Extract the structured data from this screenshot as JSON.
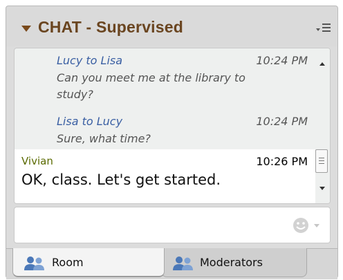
{
  "header": {
    "title": "CHAT - Supervised",
    "collapse_icon": "triangle-down-icon",
    "menu_icon": "options-menu-icon"
  },
  "messages": [
    {
      "sender": "Lucy to Lisa",
      "time": "10:24 PM",
      "text": "Can you meet me at the library to study?"
    },
    {
      "sender": "Lisa to Lucy",
      "time": "10:24 PM",
      "text": "Sure, what time?"
    }
  ],
  "current_message": {
    "sender": "Vivian",
    "time": "10:26 PM",
    "text": "OK, class. Let's get started."
  },
  "input": {
    "value": "",
    "emoji_icon": "smiley-icon"
  },
  "tabs": [
    {
      "label": "Room",
      "icon": "people-icon",
      "active": true
    },
    {
      "label": "Moderators",
      "icon": "people-icon",
      "active": false
    }
  ],
  "colors": {
    "title": "#6a4520",
    "private_sender": "#3a5fa3",
    "current_sender": "#5a6a00",
    "panel_bg": "#dcdcdc"
  }
}
